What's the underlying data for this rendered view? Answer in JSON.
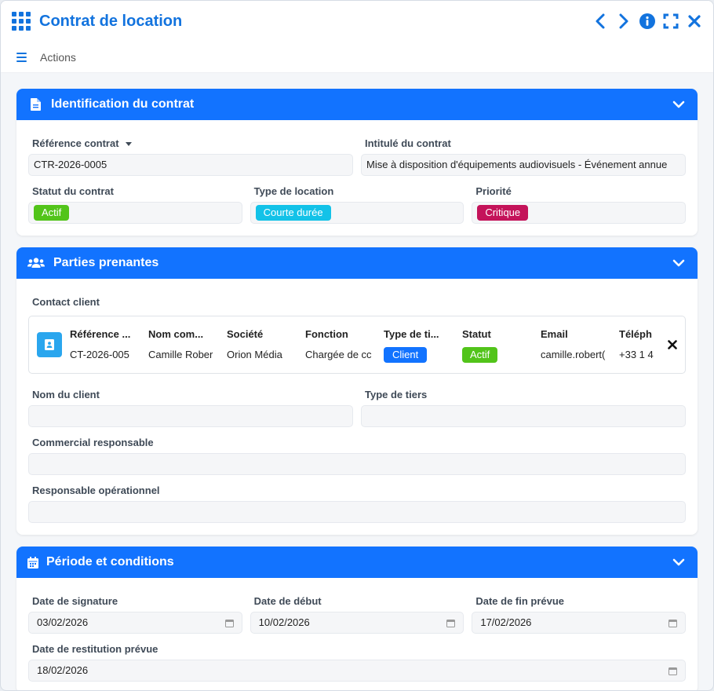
{
  "window": {
    "title": "Contrat de location"
  },
  "actions_label": "Actions",
  "sections": {
    "identification": {
      "title": "Identification du contrat",
      "fields": {
        "reference": {
          "label": "Référence contrat",
          "value": "CTR-2026-0005"
        },
        "intitule": {
          "label": "Intitulé du contrat",
          "value": "Mise à disposition d'équipements audiovisuels - Événement annue"
        },
        "statut": {
          "label": "Statut du contrat",
          "value": "Actif",
          "color": "#52c41a"
        },
        "type_location": {
          "label": "Type de location",
          "value": "Courte durée",
          "color": "#13c2e8"
        },
        "priorite": {
          "label": "Priorité",
          "value": "Critique",
          "color": "#c4135a"
        }
      }
    },
    "parties": {
      "title": "Parties prenantes",
      "contact_label": "Contact client",
      "contact": {
        "headers": [
          "Référence ...",
          "Nom com...",
          "Société",
          "Fonction",
          "Type de ti...",
          "Statut",
          "Email",
          "Téléph"
        ],
        "values": [
          "CT-2026-005",
          "Camille Rober",
          "Orion Média",
          "Chargée de cc",
          "Client",
          "Actif",
          "camille.robert(",
          "+33 1 4"
        ],
        "client_badge_color": "#1273ff",
        "actif_badge_color": "#52c41a"
      },
      "fields": {
        "nom_client": {
          "label": "Nom du client",
          "value": ""
        },
        "type_tiers": {
          "label": "Type de tiers",
          "value": ""
        },
        "commercial": {
          "label": "Commercial responsable",
          "value": ""
        },
        "responsable_op": {
          "label": "Responsable opérationnel",
          "value": ""
        }
      }
    },
    "periode": {
      "title": "Période et conditions",
      "fields": {
        "date_signature": {
          "label": "Date de signature",
          "value": "03/02/2026"
        },
        "date_debut": {
          "label": "Date de début",
          "value": "10/02/2026"
        },
        "date_fin": {
          "label": "Date de fin prévue",
          "value": "17/02/2026"
        },
        "date_restitution": {
          "label": "Date de restitution prévue",
          "value": "18/02/2026"
        }
      }
    }
  },
  "colors": {
    "accent": "#1273de",
    "section_header": "#1273ff"
  }
}
